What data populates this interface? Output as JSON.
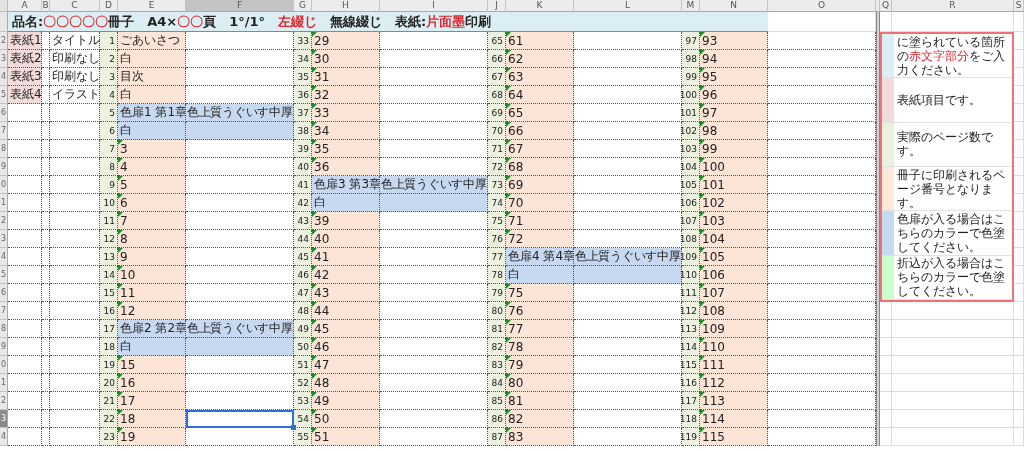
{
  "column_headers": [
    {
      "label": "A",
      "selected": false
    },
    {
      "label": "B",
      "selected": false
    },
    {
      "label": "C",
      "selected": false
    },
    {
      "label": "D",
      "selected": false
    },
    {
      "label": "E",
      "selected": false
    },
    {
      "label": "F",
      "selected": true
    },
    {
      "label": "G",
      "selected": false
    },
    {
      "label": "H",
      "selected": false
    },
    {
      "label": "I",
      "selected": false
    },
    {
      "label": "J",
      "selected": false
    },
    {
      "label": "K",
      "selected": false
    },
    {
      "label": "L",
      "selected": false
    },
    {
      "label": "M",
      "selected": false
    },
    {
      "label": "N",
      "selected": false
    },
    {
      "label": "O",
      "selected": false
    },
    {
      "label": "Q",
      "selected": false
    },
    {
      "label": "R",
      "selected": false
    },
    {
      "label": "S",
      "selected": false
    }
  ],
  "title": [
    {
      "text": "品名:",
      "kind": "plain"
    },
    {
      "text": "〇〇〇〇〇",
      "kind": "red"
    },
    {
      "text": "冊子　A4×",
      "kind": "plain"
    },
    {
      "text": "〇〇",
      "kind": "red"
    },
    {
      "text": "頁　1°/1°　",
      "kind": "plain"
    },
    {
      "text": "左綴じ",
      "kind": "red"
    },
    {
      "text": "　無線綴じ　表紙:",
      "kind": "plain"
    },
    {
      "text": "片面墨",
      "kind": "red"
    },
    {
      "text": "印刷",
      "kind": "plain"
    }
  ],
  "rows": [
    {
      "row_header": "2",
      "selected": false,
      "cover": {
        "label": "表紙1",
        "text": "タイトル"
      },
      "groups": [
        {
          "num": "1",
          "page": "ごあいさつ",
          "kind": "page",
          "flag": false,
          "selected": false
        },
        {
          "num": "33",
          "page": "29",
          "kind": "page",
          "flag": true,
          "selected": false
        },
        {
          "num": "65",
          "page": "61",
          "kind": "page",
          "flag": true,
          "selected": false
        },
        {
          "num": "97",
          "page": "93",
          "kind": "page",
          "flag": true,
          "selected": false
        }
      ]
    },
    {
      "row_header": "3",
      "selected": false,
      "cover": {
        "label": "表紙2",
        "text": "印刷なし"
      },
      "groups": [
        {
          "num": "2",
          "page": "白",
          "kind": "page",
          "flag": false,
          "selected": false
        },
        {
          "num": "34",
          "page": "30",
          "kind": "page",
          "flag": true,
          "selected": false
        },
        {
          "num": "66",
          "page": "62",
          "kind": "page",
          "flag": true,
          "selected": false
        },
        {
          "num": "98",
          "page": "94",
          "kind": "page",
          "flag": true,
          "selected": false
        }
      ]
    },
    {
      "row_header": "4",
      "selected": false,
      "cover": {
        "label": "表紙3",
        "text": "印刷なし"
      },
      "groups": [
        {
          "num": "3",
          "page": "目次",
          "kind": "page",
          "flag": false,
          "selected": false
        },
        {
          "num": "35",
          "page": "31",
          "kind": "page",
          "flag": true,
          "selected": false
        },
        {
          "num": "67",
          "page": "63",
          "kind": "page",
          "flag": true,
          "selected": false
        },
        {
          "num": "99",
          "page": "95",
          "kind": "page",
          "flag": true,
          "selected": false
        }
      ]
    },
    {
      "row_header": "5",
      "selected": false,
      "cover": {
        "label": "表紙4",
        "text": "イラスト"
      },
      "groups": [
        {
          "num": "4",
          "page": "白",
          "kind": "page",
          "flag": false,
          "selected": false
        },
        {
          "num": "36",
          "page": "32",
          "kind": "page",
          "flag": true,
          "selected": false
        },
        {
          "num": "68",
          "page": "64",
          "kind": "page",
          "flag": true,
          "selected": false
        },
        {
          "num": "100",
          "page": "96",
          "kind": "page",
          "flag": true,
          "selected": false
        }
      ]
    },
    {
      "row_header": "6",
      "selected": false,
      "groups": [
        {
          "num": "5",
          "page": "色扉1 第1章",
          "note": "色上質うぐいす中厚",
          "kind": "insert",
          "flag": false,
          "selected": false
        },
        {
          "num": "37",
          "page": "33",
          "kind": "page",
          "flag": true,
          "selected": false
        },
        {
          "num": "69",
          "page": "65",
          "kind": "page",
          "flag": true,
          "selected": false
        },
        {
          "num": "101",
          "page": "97",
          "kind": "page",
          "flag": true,
          "selected": false
        }
      ]
    },
    {
      "row_header": "7",
      "selected": false,
      "groups": [
        {
          "num": "6",
          "page": "白",
          "kind": "insert",
          "flag": false,
          "selected": false
        },
        {
          "num": "38",
          "page": "34",
          "kind": "page",
          "flag": true,
          "selected": false
        },
        {
          "num": "70",
          "page": "66",
          "kind": "page",
          "flag": true,
          "selected": false
        },
        {
          "num": "102",
          "page": "98",
          "kind": "page",
          "flag": true,
          "selected": false
        }
      ]
    },
    {
      "row_header": "8",
      "selected": false,
      "groups": [
        {
          "num": "7",
          "page": "3",
          "kind": "page",
          "flag": true,
          "selected": false
        },
        {
          "num": "39",
          "page": "35",
          "kind": "page",
          "flag": true,
          "selected": false
        },
        {
          "num": "71",
          "page": "67",
          "kind": "page",
          "flag": true,
          "selected": false
        },
        {
          "num": "103",
          "page": "99",
          "kind": "page",
          "flag": true,
          "selected": false
        }
      ]
    },
    {
      "row_header": "9",
      "selected": false,
      "groups": [
        {
          "num": "8",
          "page": "4",
          "kind": "page",
          "flag": true,
          "selected": false
        },
        {
          "num": "40",
          "page": "36",
          "kind": "page",
          "flag": true,
          "selected": false
        },
        {
          "num": "72",
          "page": "68",
          "kind": "page",
          "flag": true,
          "selected": false
        },
        {
          "num": "104",
          "page": "100",
          "kind": "page",
          "flag": true,
          "selected": false
        }
      ]
    },
    {
      "row_header": "0",
      "selected": false,
      "groups": [
        {
          "num": "9",
          "page": "5",
          "kind": "page",
          "flag": true,
          "selected": false
        },
        {
          "num": "41",
          "page": "色扉3 第3章",
          "note": "色上質うぐいす中厚",
          "kind": "insert",
          "flag": false,
          "selected": false
        },
        {
          "num": "73",
          "page": "69",
          "kind": "page",
          "flag": true,
          "selected": false
        },
        {
          "num": "105",
          "page": "101",
          "kind": "page",
          "flag": true,
          "selected": false
        }
      ]
    },
    {
      "row_header": "1",
      "selected": false,
      "groups": [
        {
          "num": "10",
          "page": "6",
          "kind": "page",
          "flag": true,
          "selected": false
        },
        {
          "num": "42",
          "page": "白",
          "kind": "insert",
          "flag": false,
          "selected": false
        },
        {
          "num": "74",
          "page": "70",
          "kind": "page",
          "flag": true,
          "selected": false
        },
        {
          "num": "106",
          "page": "102",
          "kind": "page",
          "flag": true,
          "selected": false
        }
      ]
    },
    {
      "row_header": "2",
      "selected": false,
      "groups": [
        {
          "num": "11",
          "page": "7",
          "kind": "page",
          "flag": true,
          "selected": false
        },
        {
          "num": "43",
          "page": "39",
          "kind": "page",
          "flag": true,
          "selected": false
        },
        {
          "num": "75",
          "page": "71",
          "kind": "page",
          "flag": true,
          "selected": false
        },
        {
          "num": "107",
          "page": "103",
          "kind": "page",
          "flag": true,
          "selected": false
        }
      ]
    },
    {
      "row_header": "3",
      "selected": false,
      "groups": [
        {
          "num": "12",
          "page": "8",
          "kind": "page",
          "flag": true,
          "selected": false
        },
        {
          "num": "44",
          "page": "40",
          "kind": "page",
          "flag": true,
          "selected": false
        },
        {
          "num": "76",
          "page": "72",
          "kind": "page",
          "flag": true,
          "selected": false
        },
        {
          "num": "108",
          "page": "104",
          "kind": "page",
          "flag": true,
          "selected": false
        }
      ]
    },
    {
      "row_header": "4",
      "selected": false,
      "groups": [
        {
          "num": "13",
          "page": "9",
          "kind": "page",
          "flag": true,
          "selected": false
        },
        {
          "num": "45",
          "page": "41",
          "kind": "page",
          "flag": true,
          "selected": false
        },
        {
          "num": "77",
          "page": "色扉4 第4章",
          "note": "色上質うぐいす中厚",
          "kind": "insert",
          "flag": false,
          "selected": false
        },
        {
          "num": "109",
          "page": "105",
          "kind": "page",
          "flag": true,
          "selected": false
        }
      ]
    },
    {
      "row_header": "5",
      "selected": false,
      "groups": [
        {
          "num": "14",
          "page": "10",
          "kind": "page",
          "flag": true,
          "selected": false
        },
        {
          "num": "46",
          "page": "42",
          "kind": "page",
          "flag": true,
          "selected": false
        },
        {
          "num": "78",
          "page": "白",
          "kind": "insert",
          "flag": false,
          "selected": false
        },
        {
          "num": "110",
          "page": "106",
          "kind": "page",
          "flag": true,
          "selected": false
        }
      ]
    },
    {
      "row_header": "6",
      "selected": false,
      "groups": [
        {
          "num": "15",
          "page": "11",
          "kind": "page",
          "flag": true,
          "selected": false
        },
        {
          "num": "47",
          "page": "43",
          "kind": "page",
          "flag": true,
          "selected": false
        },
        {
          "num": "79",
          "page": "75",
          "kind": "page",
          "flag": true,
          "selected": false
        },
        {
          "num": "111",
          "page": "107",
          "kind": "page",
          "flag": true,
          "selected": false
        }
      ]
    },
    {
      "row_header": "7",
      "selected": false,
      "groups": [
        {
          "num": "16",
          "page": "12",
          "kind": "page",
          "flag": true,
          "selected": false
        },
        {
          "num": "48",
          "page": "44",
          "kind": "page",
          "flag": true,
          "selected": false
        },
        {
          "num": "80",
          "page": "76",
          "kind": "page",
          "flag": true,
          "selected": false
        },
        {
          "num": "112",
          "page": "108",
          "kind": "page",
          "flag": true,
          "selected": false
        }
      ]
    },
    {
      "row_header": "8",
      "selected": false,
      "groups": [
        {
          "num": "17",
          "page": "色扉2 第2章",
          "note": "色上質うぐいす中厚",
          "kind": "insert",
          "flag": false,
          "selected": false
        },
        {
          "num": "49",
          "page": "45",
          "kind": "page",
          "flag": true,
          "selected": false
        },
        {
          "num": "81",
          "page": "77",
          "kind": "page",
          "flag": true,
          "selected": false
        },
        {
          "num": "113",
          "page": "109",
          "kind": "page",
          "flag": true,
          "selected": false
        }
      ]
    },
    {
      "row_header": "9",
      "selected": false,
      "groups": [
        {
          "num": "18",
          "page": "白",
          "kind": "insert",
          "flag": false,
          "selected": false
        },
        {
          "num": "50",
          "page": "46",
          "kind": "page",
          "flag": true,
          "selected": false
        },
        {
          "num": "82",
          "page": "78",
          "kind": "page",
          "flag": true,
          "selected": false
        },
        {
          "num": "114",
          "page": "110",
          "kind": "page",
          "flag": true,
          "selected": false
        }
      ]
    },
    {
      "row_header": "0",
      "selected": false,
      "groups": [
        {
          "num": "19",
          "page": "15",
          "kind": "page",
          "flag": true,
          "selected": false
        },
        {
          "num": "51",
          "page": "47",
          "kind": "page",
          "flag": true,
          "selected": false
        },
        {
          "num": "83",
          "page": "79",
          "kind": "page",
          "flag": true,
          "selected": false
        },
        {
          "num": "115",
          "page": "111",
          "kind": "page",
          "flag": true,
          "selected": false
        }
      ]
    },
    {
      "row_header": "1",
      "selected": false,
      "groups": [
        {
          "num": "20",
          "page": "16",
          "kind": "page",
          "flag": true,
          "selected": false
        },
        {
          "num": "52",
          "page": "48",
          "kind": "page",
          "flag": true,
          "selected": false
        },
        {
          "num": "84",
          "page": "80",
          "kind": "page",
          "flag": true,
          "selected": false
        },
        {
          "num": "116",
          "page": "112",
          "kind": "page",
          "flag": true,
          "selected": false
        }
      ]
    },
    {
      "row_header": "2",
      "selected": false,
      "groups": [
        {
          "num": "21",
          "page": "17",
          "kind": "page",
          "flag": true,
          "selected": false
        },
        {
          "num": "53",
          "page": "49",
          "kind": "page",
          "flag": true,
          "selected": false
        },
        {
          "num": "85",
          "page": "81",
          "kind": "page",
          "flag": true,
          "selected": false
        },
        {
          "num": "117",
          "page": "113",
          "kind": "page",
          "flag": true,
          "selected": false
        }
      ]
    },
    {
      "row_header": "3",
      "selected": true,
      "groups": [
        {
          "num": "22",
          "page": "18",
          "kind": "page",
          "flag": true,
          "selected": true
        },
        {
          "num": "54",
          "page": "50",
          "kind": "page",
          "flag": true,
          "selected": false
        },
        {
          "num": "86",
          "page": "82",
          "kind": "page",
          "flag": true,
          "selected": false
        },
        {
          "num": "118",
          "page": "114",
          "kind": "page",
          "flag": true,
          "selected": false
        }
      ]
    },
    {
      "row_header": "4",
      "selected": false,
      "groups": [
        {
          "num": "23",
          "page": "19",
          "kind": "page",
          "flag": true,
          "selected": false
        },
        {
          "num": "55",
          "page": "51",
          "kind": "page",
          "flag": true,
          "selected": false
        },
        {
          "num": "87",
          "page": "83",
          "kind": "page",
          "flag": true,
          "selected": false
        },
        {
          "num": "119",
          "page": "115",
          "kind": "page",
          "flag": true,
          "selected": false
        }
      ]
    }
  ],
  "legend": [
    {
      "color": "#daeef3",
      "segments": [
        {
          "text": "に塗られている箇所の",
          "kind": "plain"
        },
        {
          "text": "赤文字部分",
          "kind": "red"
        },
        {
          "text": "をご入力ください。",
          "kind": "plain"
        }
      ]
    },
    {
      "color": "#f2dcdb",
      "segments": [
        {
          "text": "表紙項目です。",
          "kind": "plain"
        }
      ]
    },
    {
      "color": "#ebf1de",
      "segments": [
        {
          "text": "実際のページ数です。",
          "kind": "plain"
        }
      ]
    },
    {
      "color": "#fde9d9",
      "segments": [
        {
          "text": "冊子に印刷されるページ番号となります。",
          "kind": "plain"
        }
      ]
    },
    {
      "color": "#c5d9f1",
      "segments": [
        {
          "text": "色扉が入る場合はこちらのカラーで色塗してください。",
          "kind": "plain"
        }
      ]
    },
    {
      "color": "#ccffcc",
      "segments": [
        {
          "text": "折込が入る場合はこちらのカラーで色塗してください。",
          "kind": "plain"
        }
      ]
    }
  ]
}
